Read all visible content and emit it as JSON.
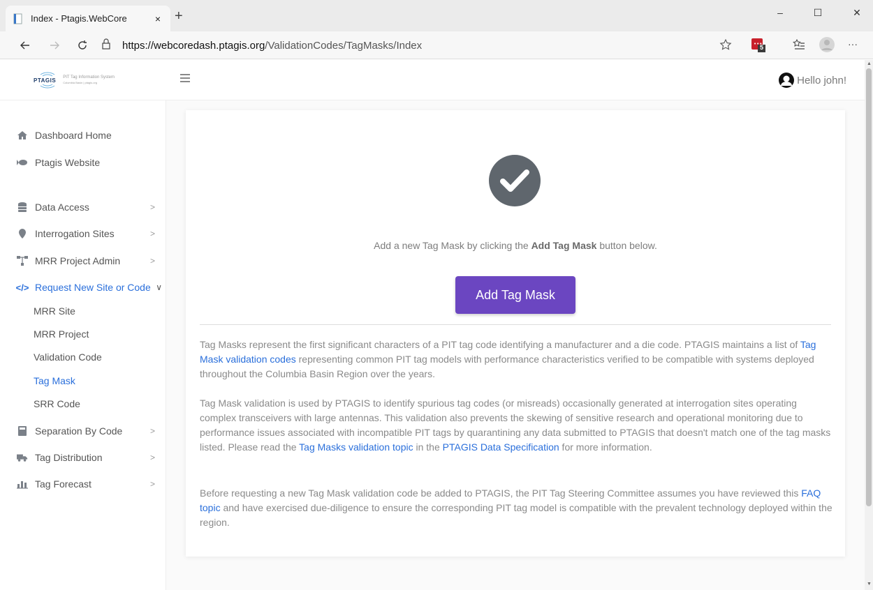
{
  "browser": {
    "tab_title": "Index - Ptagis.WebCore",
    "tab_close": "×",
    "new_tab": "+",
    "url_scheme_host": "https://webcoredash.ptagis.org",
    "url_path": "/ValidationCodes/TagMasks/Index",
    "extension_badge": "5",
    "minimize": "–",
    "maximize": "☐",
    "close": "✕",
    "more": "···"
  },
  "header": {
    "logo_text": "PTAGIS",
    "logo_subtitle_1": "PIT Tag Information System",
    "logo_subtitle_2": "Columbia Basin | ptagis.org",
    "greeting": "Hello john!"
  },
  "sidebar": {
    "items": [
      {
        "label": "Dashboard Home",
        "icon": "home-icon"
      },
      {
        "label": "Ptagis Website",
        "icon": "fish-icon"
      },
      {
        "label": "Data Access",
        "icon": "database-icon",
        "chevron": ">"
      },
      {
        "label": "Interrogation Sites",
        "icon": "map-pin-icon",
        "chevron": ">"
      },
      {
        "label": "MRR Project Admin",
        "icon": "sitemap-icon",
        "chevron": ">"
      },
      {
        "label": "Request New Site or Code",
        "icon": "code-icon",
        "chevron": "∨"
      },
      {
        "label": "Separation By Code",
        "icon": "calculator-icon",
        "chevron": ">"
      },
      {
        "label": "Tag Distribution",
        "icon": "truck-icon",
        "chevron": ">"
      },
      {
        "label": "Tag Forecast",
        "icon": "chart-icon",
        "chevron": ">"
      }
    ],
    "subitems": [
      "MRR Site",
      "MRR Project",
      "Validation Code",
      "Tag Mask",
      "SRR Code"
    ]
  },
  "main": {
    "lead_prefix": "Add a new Tag Mask by clicking the ",
    "lead_bold": "Add Tag Mask",
    "lead_suffix": " button below.",
    "add_button": "Add Tag Mask",
    "p1_a": "Tag Masks represent the first significant characters of a PIT tag code identifying a manufacturer and a die code. PTAGIS maintains a list of ",
    "p1_link": "Tag Mask validation codes",
    "p1_b": " representing common PIT tag models with performance characteristics verified to be compatible with systems deployed throughout the Columbia Basin Region over the years.",
    "p2_a": "Tag Mask validation is used by PTAGIS to identify spurious tag codes (or misreads) occasionally generated at interrogation sites operating complex transceivers with large antennas. This validation also prevents the skewing of sensitive research and operational monitoring due to performance issues associated with incompatible PIT tags by quarantining any data submitted to PTAGIS that doesn't match one of the tag masks listed. Please read the ",
    "p2_link1": "Tag Masks validation topic",
    "p2_b": " in the ",
    "p2_link2": "PTAGIS Data Specification",
    "p2_c": " for more information.",
    "p3_a": "Before requesting a new Tag Mask validation code be added to PTAGIS, the PIT Tag Steering Committee assumes you have reviewed this ",
    "p3_link": "FAQ topic",
    "p3_b": " and have exercised due-diligence to ensure the corresponding PIT tag model is compatible with the prevalent technology deployed within the region."
  },
  "colors": {
    "accent_purple": "#6b46c1",
    "link_blue": "#2a6fdb",
    "check_gray": "#5f666d"
  }
}
